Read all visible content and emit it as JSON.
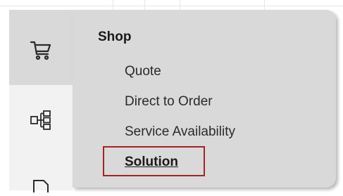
{
  "menu": {
    "heading": "Shop",
    "items": [
      {
        "label": "Quote"
      },
      {
        "label": "Direct to Order"
      },
      {
        "label": "Service Availability"
      },
      {
        "label": "Solution"
      }
    ]
  },
  "rail": {
    "items": [
      {
        "icon": "cart-icon"
      },
      {
        "icon": "solution-tree-icon"
      },
      {
        "icon": "document-icon"
      }
    ]
  },
  "colors": {
    "panel": "#d9d9d9",
    "rail": "#f2f2f2",
    "highlight": "#a32424"
  }
}
